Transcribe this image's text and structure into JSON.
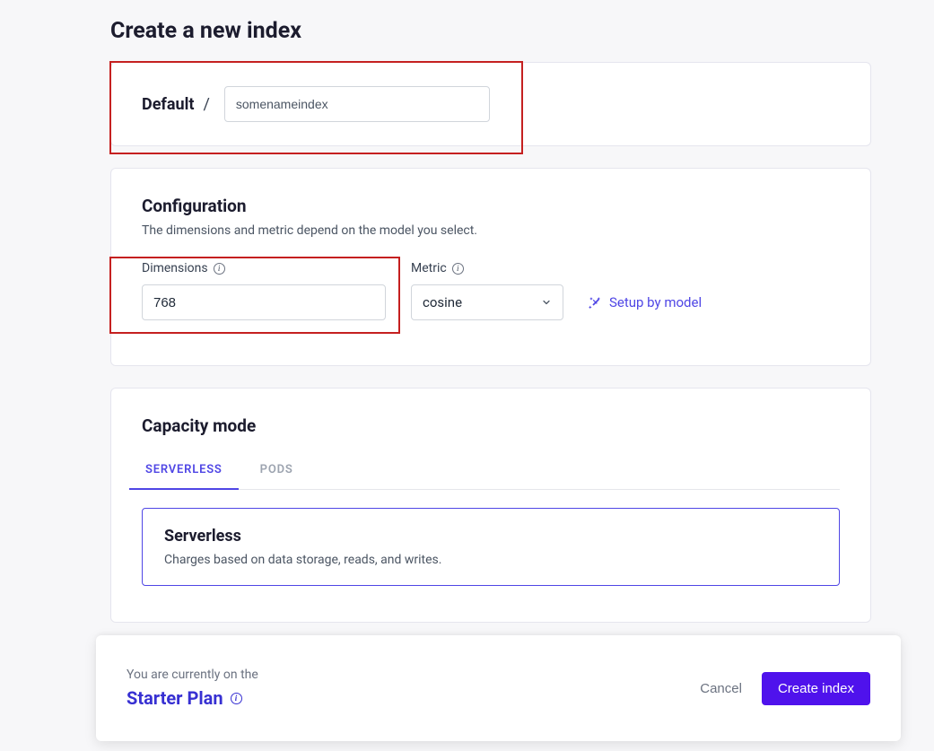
{
  "page": {
    "title": "Create a new index"
  },
  "nameRow": {
    "prefix": "Default",
    "separator": "/",
    "indexName": "somenameindex"
  },
  "config": {
    "heading": "Configuration",
    "description": "The dimensions and metric depend on the model you select.",
    "dimensions": {
      "label": "Dimensions",
      "value": "768"
    },
    "metric": {
      "label": "Metric",
      "value": "cosine"
    },
    "setupByModel": "Setup by model"
  },
  "capacity": {
    "heading": "Capacity mode",
    "tabs": {
      "serverless": "SERVERLESS",
      "pods": "PODS"
    },
    "selected": {
      "title": "Serverless",
      "description": "Charges based on data storage, reads, and writes."
    }
  },
  "footer": {
    "currentlyOn": "You are currently on the",
    "plan": "Starter Plan",
    "cancel": "Cancel",
    "create": "Create index"
  }
}
